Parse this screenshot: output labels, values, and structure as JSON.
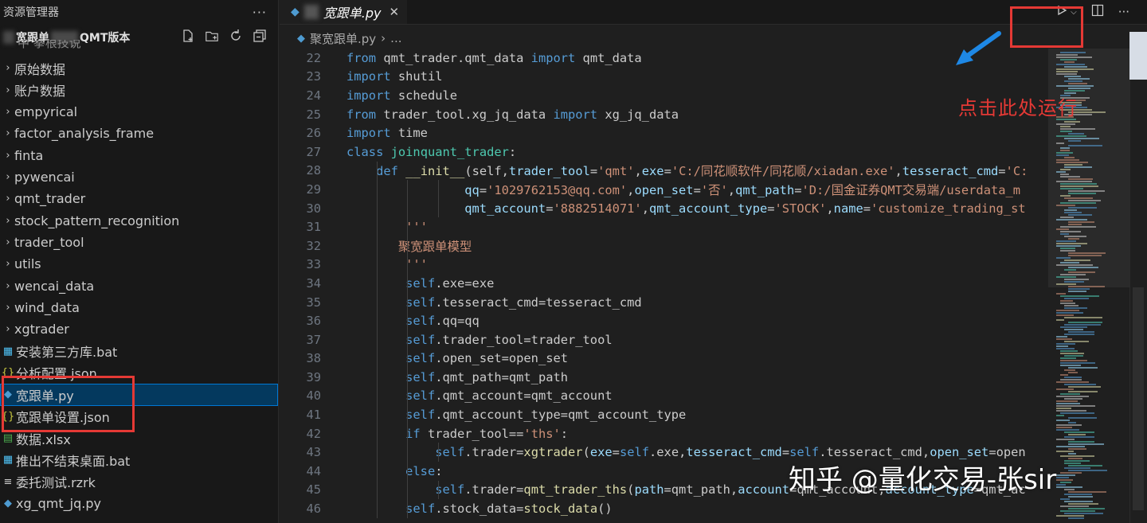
{
  "explorer": {
    "title": "资源管理器",
    "folder_name_a": "宽跟单",
    "folder_name_b": "QMT版本",
    "partial_row": "中 拳根技说",
    "items": [
      {
        "label": "原始数据",
        "type": "folder"
      },
      {
        "label": "账户数据",
        "type": "folder"
      },
      {
        "label": "empyrical",
        "type": "folder"
      },
      {
        "label": "factor_analysis_frame",
        "type": "folder"
      },
      {
        "label": "finta",
        "type": "folder"
      },
      {
        "label": "pywencai",
        "type": "folder"
      },
      {
        "label": "qmt_trader",
        "type": "folder"
      },
      {
        "label": "stock_pattern_recognition",
        "type": "folder"
      },
      {
        "label": "trader_tool",
        "type": "folder"
      },
      {
        "label": "utils",
        "type": "folder"
      },
      {
        "label": "wencai_data",
        "type": "folder"
      },
      {
        "label": "wind_data",
        "type": "folder"
      },
      {
        "label": "xgtrader",
        "type": "folder"
      },
      {
        "label": "安装第三方库.bat",
        "type": "bat"
      },
      {
        "label": "分析配置.json",
        "type": "json"
      },
      {
        "label": "宽跟单.py",
        "type": "py",
        "selected": true
      },
      {
        "label": "宽跟单设置.json",
        "type": "json"
      },
      {
        "label": "数据.xlsx",
        "type": "xlsx"
      },
      {
        "label": "推出不结束桌面.bat",
        "type": "bat"
      },
      {
        "label": "委托测试.rzrk",
        "type": "rzrk"
      },
      {
        "label": "xg_qmt_jq.py",
        "type": "py"
      }
    ]
  },
  "editor": {
    "tab_label": "宽跟单.py",
    "breadcrumb_file": "聚宽跟单.py",
    "breadcrumb_more": "...",
    "lines": [
      {
        "n": "22",
        "indent": 0,
        "tokens": [
          [
            "kw",
            "from"
          ],
          [
            "t",
            " qmt_trader.qmt_data "
          ],
          [
            "kw",
            "import"
          ],
          [
            "t",
            " qmt_data"
          ]
        ]
      },
      {
        "n": "23",
        "indent": 0,
        "tokens": [
          [
            "kw",
            "import"
          ],
          [
            "t",
            " shutil"
          ]
        ]
      },
      {
        "n": "24",
        "indent": 0,
        "tokens": [
          [
            "kw",
            "import"
          ],
          [
            "t",
            " schedule"
          ]
        ]
      },
      {
        "n": "25",
        "indent": 0,
        "tokens": [
          [
            "kw",
            "from"
          ],
          [
            "t",
            " trader_tool.xg_jq_data "
          ],
          [
            "kw",
            "import"
          ],
          [
            "t",
            " xg_jq_data"
          ]
        ]
      },
      {
        "n": "26",
        "indent": 0,
        "tokens": [
          [
            "kw",
            "import"
          ],
          [
            "t",
            " time"
          ]
        ]
      },
      {
        "n": "27",
        "indent": 0,
        "tokens": [
          [
            "kw",
            "class"
          ],
          [
            "t",
            " "
          ],
          [
            "cls",
            "joinquant_trader"
          ],
          [
            "t",
            ":"
          ]
        ]
      },
      {
        "n": "28",
        "indent": 1,
        "tokens": [
          [
            "kw",
            "def"
          ],
          [
            "t",
            " "
          ],
          [
            "fn",
            "__init__"
          ],
          [
            "t",
            "(self,"
          ],
          [
            "p",
            "trader_tool"
          ],
          [
            "t",
            "="
          ],
          [
            "s",
            "'qmt'"
          ],
          [
            "t",
            ","
          ],
          [
            "p",
            "exe"
          ],
          [
            "t",
            "="
          ],
          [
            "s",
            "'C:/同花顺软件/同花顺/xiadan.exe'"
          ],
          [
            "t",
            ","
          ],
          [
            "p",
            "tesseract_cmd"
          ],
          [
            "t",
            "="
          ],
          [
            "s",
            "'C:"
          ]
        ]
      },
      {
        "n": "29",
        "indent": 4,
        "tokens": [
          [
            "p",
            "qq"
          ],
          [
            "t",
            "="
          ],
          [
            "s",
            "'1029762153@qq.com'"
          ],
          [
            "t",
            ","
          ],
          [
            "p",
            "open_set"
          ],
          [
            "t",
            "="
          ],
          [
            "s",
            "'否'"
          ],
          [
            "t",
            ","
          ],
          [
            "p",
            "qmt_path"
          ],
          [
            "t",
            "="
          ],
          [
            "s",
            "'D:/国金证券QMT交易端/userdata_m"
          ]
        ]
      },
      {
        "n": "30",
        "indent": 4,
        "tokens": [
          [
            "p",
            "qmt_account"
          ],
          [
            "t",
            "="
          ],
          [
            "s",
            "'8882514071'"
          ],
          [
            "t",
            ","
          ],
          [
            "p",
            "qmt_account_type"
          ],
          [
            "t",
            "="
          ],
          [
            "s",
            "'STOCK'"
          ],
          [
            "t",
            ","
          ],
          [
            "p",
            "name"
          ],
          [
            "t",
            "="
          ],
          [
            "s",
            "'customize_trading_st"
          ]
        ]
      },
      {
        "n": "31",
        "indent": 2,
        "tokens": [
          [
            "s",
            "'''"
          ]
        ]
      },
      {
        "n": "32",
        "indent": 2,
        "tokens": [
          [
            "s",
            "聚宽跟单模型"
          ]
        ],
        "shift": -1
      },
      {
        "n": "33",
        "indent": 2,
        "tokens": [
          [
            "s",
            "'''"
          ]
        ]
      },
      {
        "n": "34",
        "indent": 2,
        "tokens": [
          [
            "slf",
            "self"
          ],
          [
            "t",
            ".exe=exe"
          ]
        ]
      },
      {
        "n": "35",
        "indent": 2,
        "tokens": [
          [
            "slf",
            "self"
          ],
          [
            "t",
            ".tesseract_cmd=tesseract_cmd"
          ]
        ]
      },
      {
        "n": "36",
        "indent": 2,
        "tokens": [
          [
            "slf",
            "self"
          ],
          [
            "t",
            ".qq=qq"
          ]
        ]
      },
      {
        "n": "37",
        "indent": 2,
        "tokens": [
          [
            "slf",
            "self"
          ],
          [
            "t",
            ".trader_tool=trader_tool"
          ]
        ]
      },
      {
        "n": "38",
        "indent": 2,
        "tokens": [
          [
            "slf",
            "self"
          ],
          [
            "t",
            ".open_set=open_set"
          ]
        ]
      },
      {
        "n": "39",
        "indent": 2,
        "tokens": [
          [
            "slf",
            "self"
          ],
          [
            "t",
            ".qmt_path=qmt_path"
          ]
        ]
      },
      {
        "n": "40",
        "indent": 2,
        "tokens": [
          [
            "slf",
            "self"
          ],
          [
            "t",
            ".qmt_account=qmt_account"
          ]
        ]
      },
      {
        "n": "41",
        "indent": 2,
        "tokens": [
          [
            "slf",
            "self"
          ],
          [
            "t",
            ".qmt_account_type=qmt_account_type"
          ]
        ]
      },
      {
        "n": "42",
        "indent": 2,
        "tokens": [
          [
            "kw",
            "if"
          ],
          [
            "t",
            " trader_tool=="
          ],
          [
            "s",
            "'ths'"
          ],
          [
            "t",
            ":"
          ]
        ]
      },
      {
        "n": "43",
        "indent": 3,
        "tokens": [
          [
            "slf",
            "self"
          ],
          [
            "t",
            ".trader="
          ],
          [
            "fn",
            "xgtrader"
          ],
          [
            "t",
            "("
          ],
          [
            "p",
            "exe"
          ],
          [
            "t",
            "="
          ],
          [
            "slf",
            "self"
          ],
          [
            "t",
            ".exe,"
          ],
          [
            "p",
            "tesseract_cmd"
          ],
          [
            "t",
            "="
          ],
          [
            "slf",
            "self"
          ],
          [
            "t",
            ".tesseract_cmd,"
          ],
          [
            "p",
            "open_set"
          ],
          [
            "t",
            "=open"
          ]
        ]
      },
      {
        "n": "44",
        "indent": 2,
        "tokens": [
          [
            "kw",
            "else"
          ],
          [
            "t",
            ":"
          ]
        ]
      },
      {
        "n": "45",
        "indent": 3,
        "tokens": [
          [
            "slf",
            "self"
          ],
          [
            "t",
            ".trader="
          ],
          [
            "fn",
            "qmt_trader_ths"
          ],
          [
            "t",
            "("
          ],
          [
            "p",
            "path"
          ],
          [
            "t",
            "=qmt_path,"
          ],
          [
            "p",
            "account"
          ],
          [
            "t",
            "=qmt_account,"
          ],
          [
            "p",
            "account_type"
          ],
          [
            "t",
            "=qmt_ac"
          ]
        ]
      },
      {
        "n": "46",
        "indent": 2,
        "tokens": [
          [
            "slf",
            "self"
          ],
          [
            "t",
            ".stock_data="
          ],
          [
            "fn",
            "stock_data"
          ],
          [
            "t",
            "()"
          ]
        ]
      }
    ]
  },
  "annotation": "点击此处运行",
  "watermark": "知乎 @量化交易-张sir",
  "colors": {
    "keyword": "#c586c0",
    "keyword_blue": "#569cd6",
    "class_name": "#4ec9b0",
    "function": "#dcdcaa",
    "param": "#9cdcfe",
    "string": "#ce9178",
    "self": "#569cd6",
    "text": "#cccccc",
    "annotation_red": "#e53935",
    "arrow_blue": "#1e88e5"
  }
}
